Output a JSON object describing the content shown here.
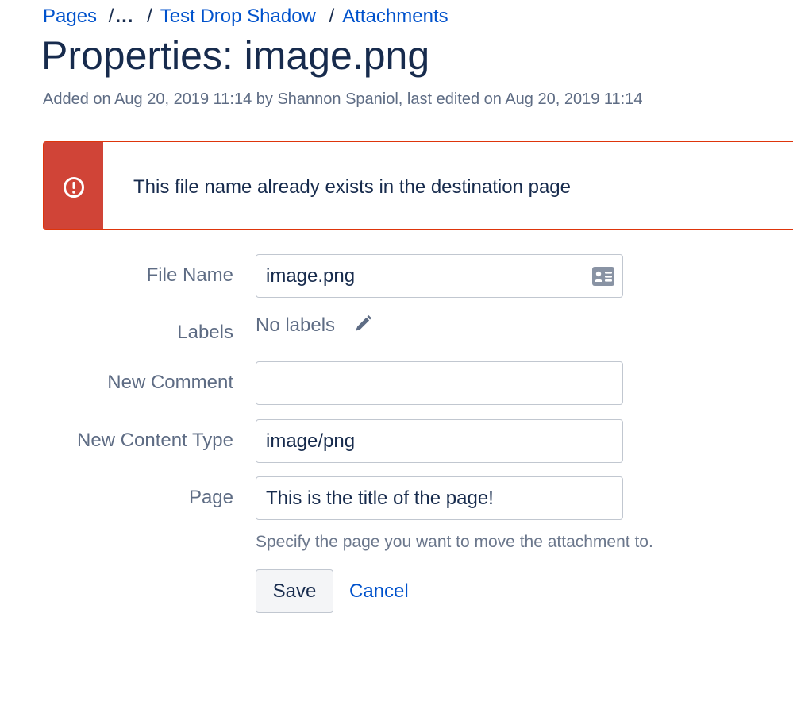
{
  "breadcrumb": {
    "items": [
      "Pages",
      "Test Drop Shadow",
      "Attachments"
    ],
    "separator": "/",
    "ellipsis": "..."
  },
  "title": "Properties: image.png",
  "meta": "Added on Aug 20, 2019 11:14 by Shannon Spaniol, last edited on Aug 20, 2019 11:14",
  "alert": {
    "message": "This file name already exists in the destination page",
    "icon": "error-icon",
    "color": "#d04437"
  },
  "form": {
    "file_name": {
      "label": "File Name",
      "value": "image.png",
      "icon": "id-card-icon"
    },
    "labels": {
      "label": "Labels",
      "value": "No labels",
      "icon": "pencil-icon"
    },
    "new_comment": {
      "label": "New Comment",
      "value": ""
    },
    "new_content_type": {
      "label": "New Content Type",
      "value": "image/png"
    },
    "page": {
      "label": "Page",
      "value": "This is the title of the page!",
      "help": "Specify the page you want to move the attachment to."
    },
    "save_label": "Save",
    "cancel_label": "Cancel"
  },
  "colors": {
    "link": "#0052cc",
    "error": "#d04437",
    "text": "#172b4d",
    "muted": "#5e6c84"
  }
}
